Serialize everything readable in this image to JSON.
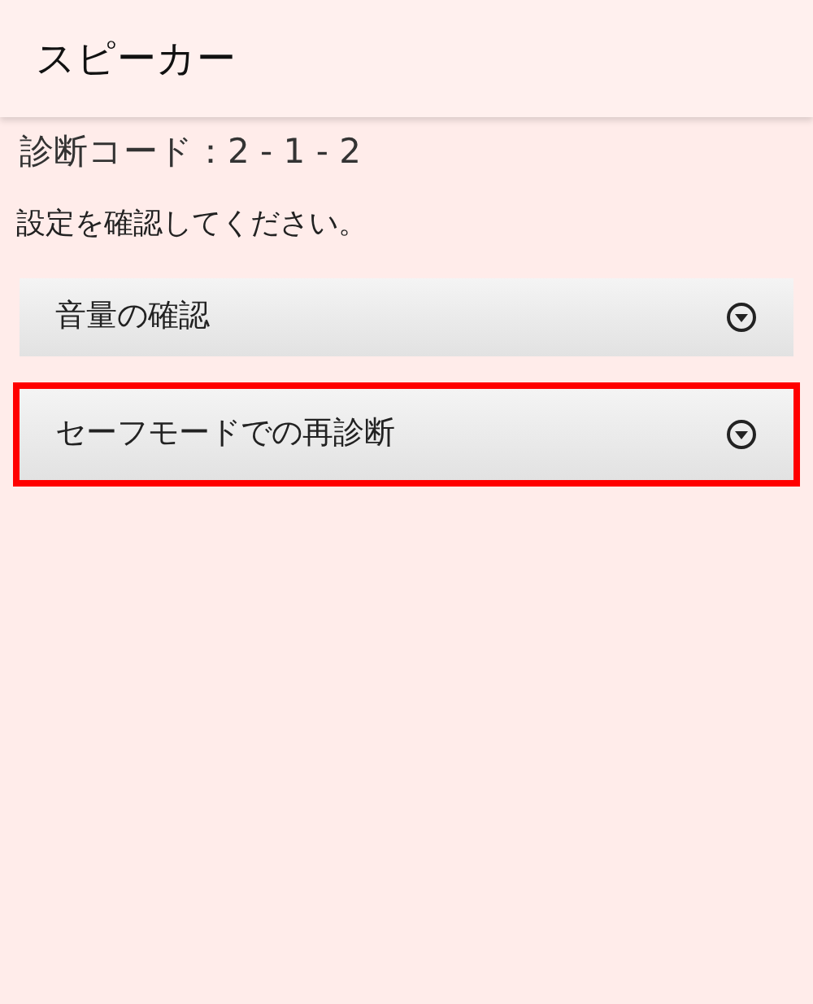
{
  "header": {
    "title": "スピーカー"
  },
  "diagnostic_code": {
    "label": "診断コード：",
    "value": "2 - 1 - 2"
  },
  "instruction": "設定を確認してください。",
  "items": [
    {
      "label": "音量の確認",
      "highlighted": false
    },
    {
      "label": "セーフモードでの再診断",
      "highlighted": true
    }
  ]
}
